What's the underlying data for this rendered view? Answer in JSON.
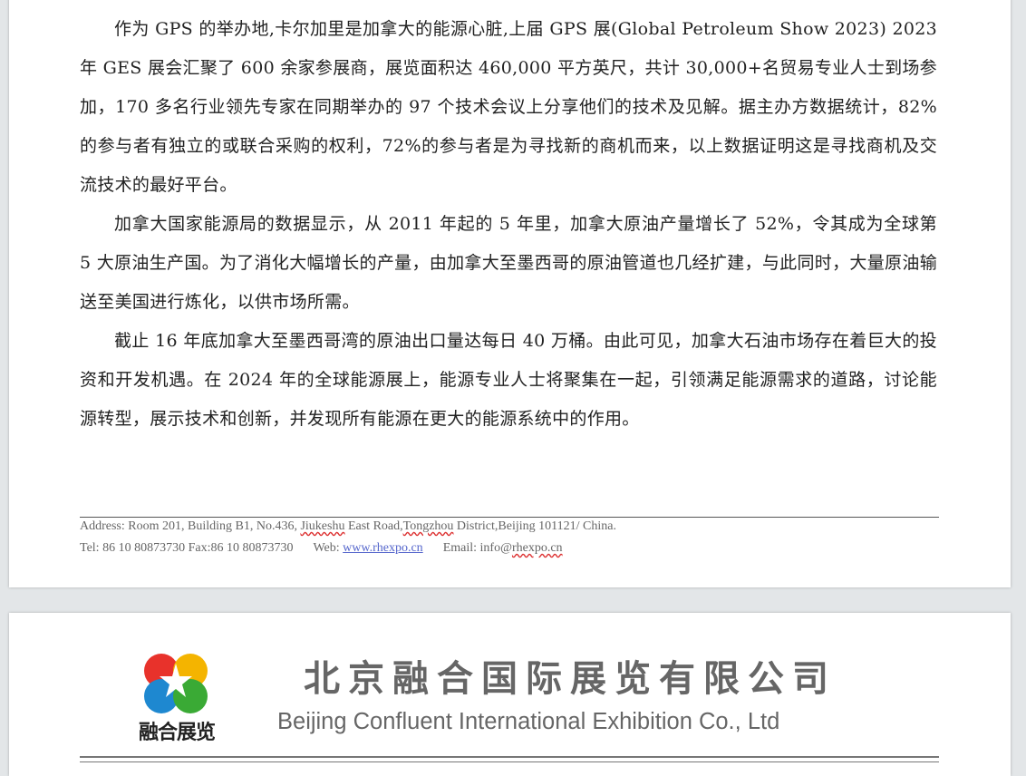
{
  "body": {
    "paragraphs": [
      "作为 GPS 的举办地,卡尔加里是加拿大的能源心脏,上届 GPS 展(Global Petroleum Show 2023) 2023 年 GES 展会汇聚了 600 余家参展商，展览面积达 460,000 平方英尺，共计 30,000+名贸易专业人士到场参加，170 多名行业领先专家在同期举办的 97 个技术会议上分享他们的技术及见解。据主办方数据统计，82%的参与者有独立的或联合采购的权利，72%的参与者是为寻找新的商机而来，以上数据证明这是寻找商机及交流技术的最好平台。",
      "加拿大国家能源局的数据显示，从 2011 年起的 5 年里，加拿大原油产量增长了 52%，令其成为全球第 5 大原油生产国。为了消化大幅增长的产量，由加拿大至墨西哥的原油管道也几经扩建，与此同时，大量原油输送至美国进行炼化，以供市场所需。",
      "截止 16 年底加拿大至墨西哥湾的原油出口量达每日 40 万桶。由此可见，加拿大石油市场存在着巨大的投资和开发机遇。在 2024 年的全球能源展上，能源专业人士将聚集在一起，引领满足能源需求的道路，讨论能源转型，展示技术和创新，并发现所有能源在更大的能源系统中的作用。"
    ]
  },
  "footer": {
    "address_prefix": "Address: Room 201, Building B1, No.436, ",
    "address_street1": "Jiukeshu",
    "address_mid": " East Road,",
    "address_district": "Tongzhou",
    "address_suffix": " District,Beijing 101121/ China.",
    "tel_fax": "Tel: 86 10 80873730 Fax:86 10 80873730",
    "web_label": "Web: ",
    "web_url": "www.rhexpo.cn",
    "email_label": "Email: info@",
    "email_domain": "rhexpo.cn"
  },
  "header": {
    "logo_text": "融合展览",
    "company_name_cn": "北京融合国际展览有限公司",
    "company_name_en": "Beijing Confluent International Exhibition Co., Ltd"
  },
  "colors": {
    "logo_red": "#e8322b",
    "logo_yellow": "#f4b400",
    "logo_green": "#3aaa35",
    "logo_blue": "#1e88d0",
    "link_blue": "#5566cc"
  }
}
